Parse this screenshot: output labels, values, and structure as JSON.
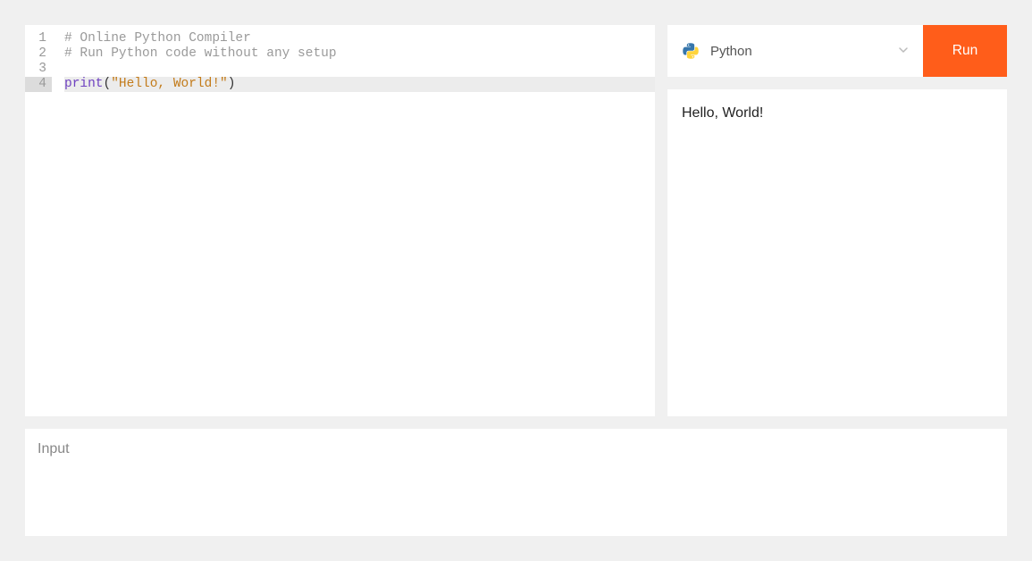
{
  "editor": {
    "lines": [
      {
        "n": 1,
        "type": "comment",
        "text": "# Online Python Compiler"
      },
      {
        "n": 2,
        "type": "comment",
        "text": "# Run Python code without any setup"
      },
      {
        "n": 3,
        "type": "blank",
        "text": ""
      },
      {
        "n": 4,
        "type": "code",
        "builtin": "print",
        "open": "(",
        "string": "\"Hello, World!\"",
        "close": ")"
      }
    ],
    "active_line": 4
  },
  "language": {
    "label": "Python"
  },
  "run_button": {
    "label": "Run"
  },
  "output": {
    "text": "Hello, World!"
  },
  "input": {
    "label": "Input"
  }
}
